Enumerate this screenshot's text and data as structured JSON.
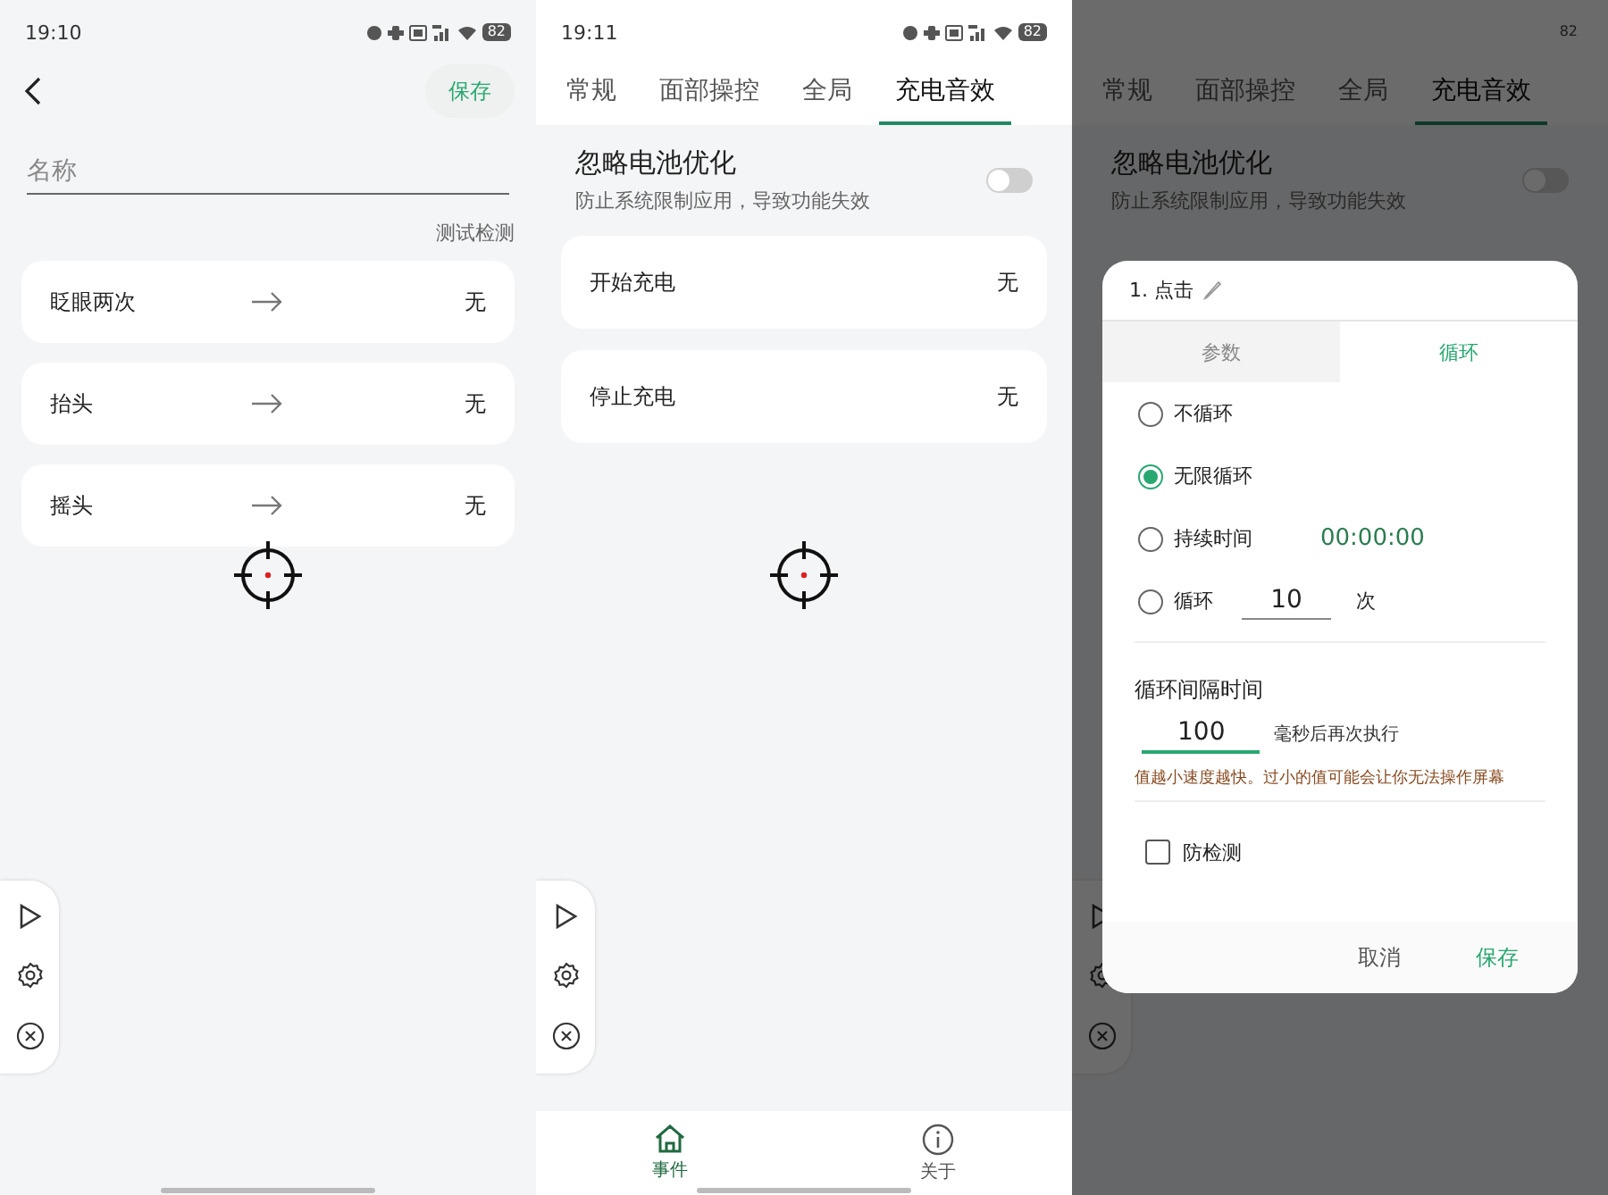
{
  "screen_1": {
    "status_bar": {
      "time": "19:10",
      "battery": "82"
    },
    "save_button": "保存",
    "name_field": {
      "placeholder": "名称"
    },
    "test_link": "测试检测",
    "gestures": [
      {
        "name": "眨眼两次",
        "action": "无"
      },
      {
        "name": "抬头",
        "action": "无"
      },
      {
        "name": "摇头",
        "action": "无"
      }
    ]
  },
  "screen_2": {
    "status_bar": {
      "time": "19:11",
      "battery": "82"
    },
    "tabs": [
      {
        "label": "常规",
        "selected": false
      },
      {
        "label": "面部操控",
        "selected": false
      },
      {
        "label": "全局",
        "selected": false
      },
      {
        "label": "充电音效",
        "selected": true
      }
    ],
    "battery_optimization": {
      "title": "忽略电池优化",
      "subtitle": "防止系统限制应用，导致功能失效",
      "on": false
    },
    "events": [
      {
        "name": "开始充电",
        "action": "无"
      },
      {
        "name": "停止充电",
        "action": "无"
      }
    ],
    "bottom_nav": [
      {
        "label": "事件",
        "selected": true
      },
      {
        "label": "关于",
        "selected": false
      }
    ]
  },
  "screen_3": {
    "status_bar": {
      "battery": "82"
    },
    "tabs": [
      {
        "label": "常规",
        "selected": false
      },
      {
        "label": "面部操控",
        "selected": false
      },
      {
        "label": "全局",
        "selected": false
      },
      {
        "label": "充电音效",
        "selected": true
      }
    ],
    "battery_optimization": {
      "title": "忽略电池优化",
      "subtitle": "防止系统限制应用，导致功能失效",
      "on": false
    },
    "dialog": {
      "title": "1. 点击",
      "tabs": [
        {
          "label": "参数",
          "selected": false
        },
        {
          "label": "循环",
          "selected": true
        }
      ],
      "loop_options": [
        {
          "kind": "plain",
          "label": "不循环",
          "selected": false
        },
        {
          "kind": "plain",
          "label": "无限循环",
          "selected": true
        },
        {
          "kind": "duration",
          "label": "持续时间",
          "value": "00:00:00",
          "selected": false
        },
        {
          "kind": "count",
          "label": "循环",
          "value": "10",
          "unit": "次",
          "selected": false
        }
      ],
      "interval": {
        "title": "循环间隔时间",
        "value": "100",
        "suffix": "毫秒后再次执行",
        "hint": "值越小速度越快。过小的值可能会让你无法操作屏幕"
      },
      "anti_detection": {
        "label": "防检测",
        "checked": false
      },
      "buttons": [
        {
          "kind": "cancel",
          "label": "取消"
        },
        {
          "kind": "save",
          "label": "保存"
        }
      ]
    }
  }
}
